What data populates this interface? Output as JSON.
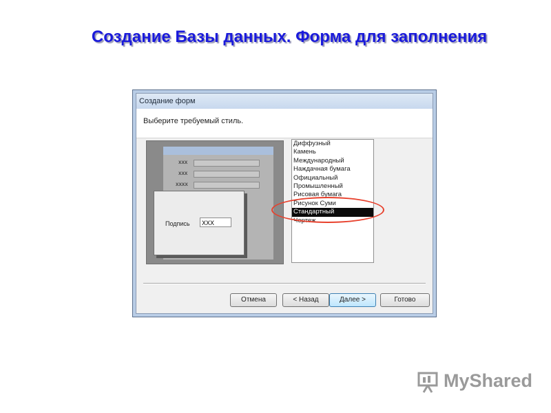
{
  "slide": {
    "title": "Создание Базы данных. Форма для заполнения"
  },
  "dialog": {
    "title": "Создание форм",
    "prompt": "Выберите требуемый стиль.",
    "preview": {
      "rows": [
        "xxx",
        "xxx",
        "xxxx"
      ],
      "front_label": "Подпись",
      "front_value": "XXX"
    },
    "styles": [
      {
        "label": "Диффузный",
        "selected": false
      },
      {
        "label": "Камень",
        "selected": false
      },
      {
        "label": "Международный",
        "selected": false
      },
      {
        "label": "Наждачная бумага",
        "selected": false
      },
      {
        "label": "Официальный",
        "selected": false
      },
      {
        "label": "Промышленный",
        "selected": false
      },
      {
        "label": "Рисовая бумага",
        "selected": false
      },
      {
        "label": "Рисунок Суми",
        "selected": false
      },
      {
        "label": "Стандартный",
        "selected": true
      },
      {
        "label": "Чертеж",
        "selected": false
      }
    ],
    "buttons": {
      "cancel": "Отмена",
      "back": "< Назад",
      "next": "Далее >",
      "finish": "Готово"
    }
  },
  "watermark": {
    "text": "MyShared"
  },
  "colors": {
    "title": "#1a1adb",
    "highlight": "#e8402c",
    "selection": "#0a0a0a"
  }
}
